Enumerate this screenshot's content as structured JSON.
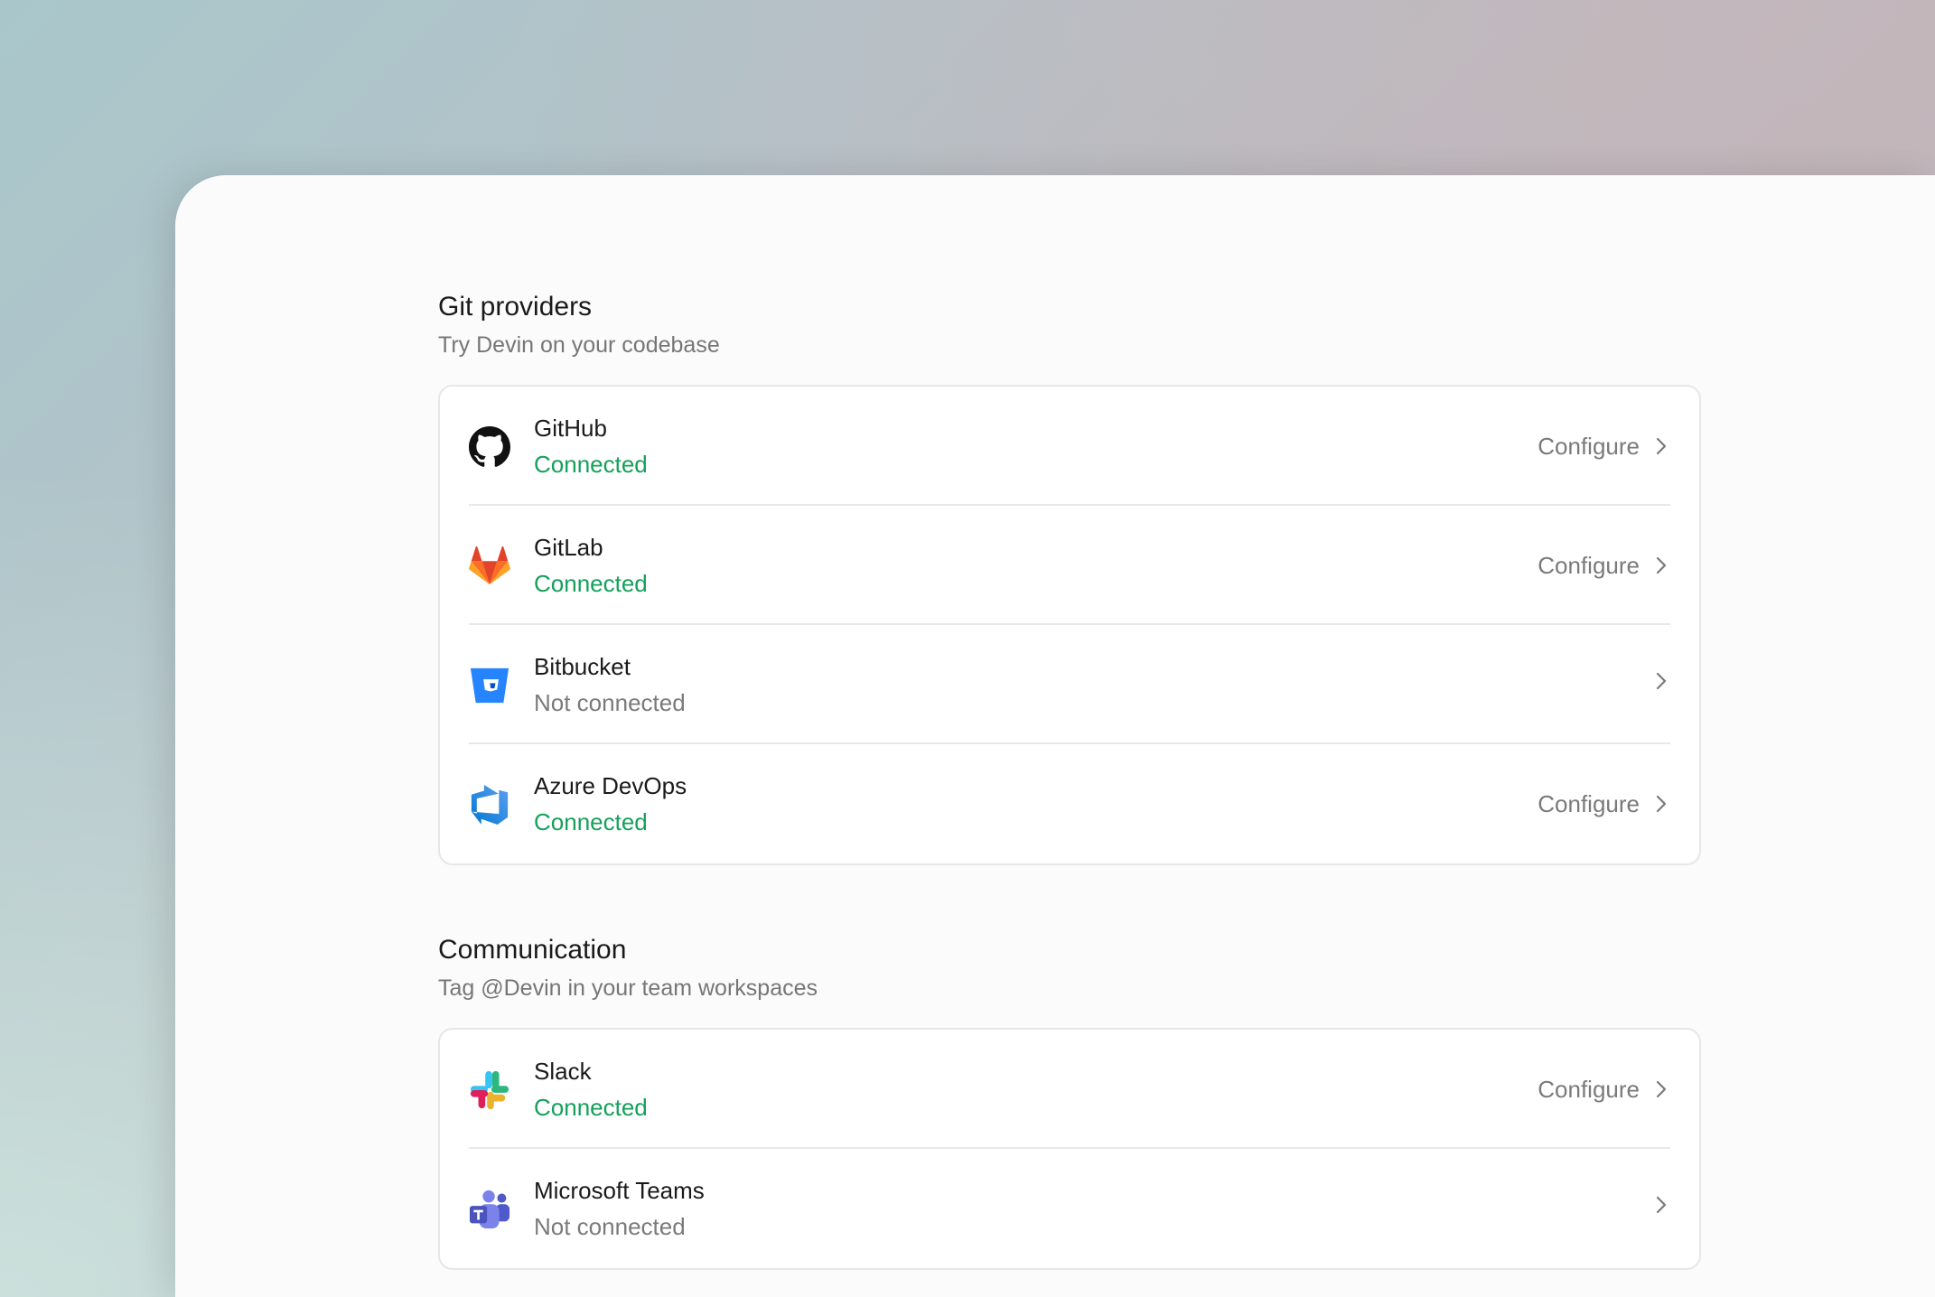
{
  "sections": [
    {
      "title": "Git providers",
      "subtitle": "Try Devin on your codebase",
      "items": [
        {
          "name": "GitHub",
          "status": "Connected",
          "connected": true,
          "action": "Configure",
          "icon": "github-icon"
        },
        {
          "name": "GitLab",
          "status": "Connected",
          "connected": true,
          "action": "Configure",
          "icon": "gitlab-icon"
        },
        {
          "name": "Bitbucket",
          "status": "Not connected",
          "connected": false,
          "action": "",
          "icon": "bitbucket-icon"
        },
        {
          "name": "Azure DevOps",
          "status": "Connected",
          "connected": true,
          "action": "Configure",
          "icon": "azure-devops-icon"
        }
      ]
    },
    {
      "title": "Communication",
      "subtitle": "Tag @Devin in your team workspaces",
      "items": [
        {
          "name": "Slack",
          "status": "Connected",
          "connected": true,
          "action": "Configure",
          "icon": "slack-icon"
        },
        {
          "name": "Microsoft Teams",
          "status": "Not connected",
          "connected": false,
          "action": "",
          "icon": "microsoft-teams-icon"
        }
      ]
    }
  ],
  "colors": {
    "connected": "#16a05b",
    "not_connected": "#7a7a7a",
    "github": "#111111",
    "gitlab": "#e24329",
    "bitbucket": "#2684ff",
    "azure": "#0078d4",
    "teams": "#5b5fc7"
  }
}
